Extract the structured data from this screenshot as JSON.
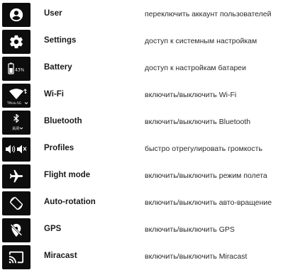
{
  "items": [
    {
      "icon": "account-circle-icon",
      "name": "User",
      "description": "переключить аккаунт пользователей"
    },
    {
      "icon": "gear-icon",
      "name": "Settings",
      "description": "доступ к системным настройкам"
    },
    {
      "icon": "battery-icon",
      "name": "Battery",
      "description": "доступ к настройкам батареи",
      "icon_text": "43%"
    },
    {
      "icon": "wifi-icon",
      "name": "Wi-Fi",
      "description": "включить/выключить Wi-Fi",
      "icon_text": "TPlink-5G"
    },
    {
      "icon": "bluetooth-icon",
      "name": "Bluetooth",
      "description": "включить/выключить Bluetooth",
      "icon_text": "关闭"
    },
    {
      "icon": "volume-mute-icon",
      "name": "Profiles",
      "description": "быстро отрегулировать громкость"
    },
    {
      "icon": "airplane-icon",
      "name": "Flight mode",
      "description": "включить/выключить режим полета"
    },
    {
      "icon": "screen-rotation-icon",
      "name": "Auto-rotation",
      "description": "включить/выключить авто-вращение"
    },
    {
      "icon": "location-off-icon",
      "name": "GPS",
      "description": "включить/выключить GPS"
    },
    {
      "icon": "cast-icon",
      "name": "Miracast",
      "description": "включить/выключить Miracast"
    }
  ],
  "colors": {
    "tile": "#0d0d0d",
    "icon": "#ffffff",
    "text": "#1a1a1a"
  }
}
